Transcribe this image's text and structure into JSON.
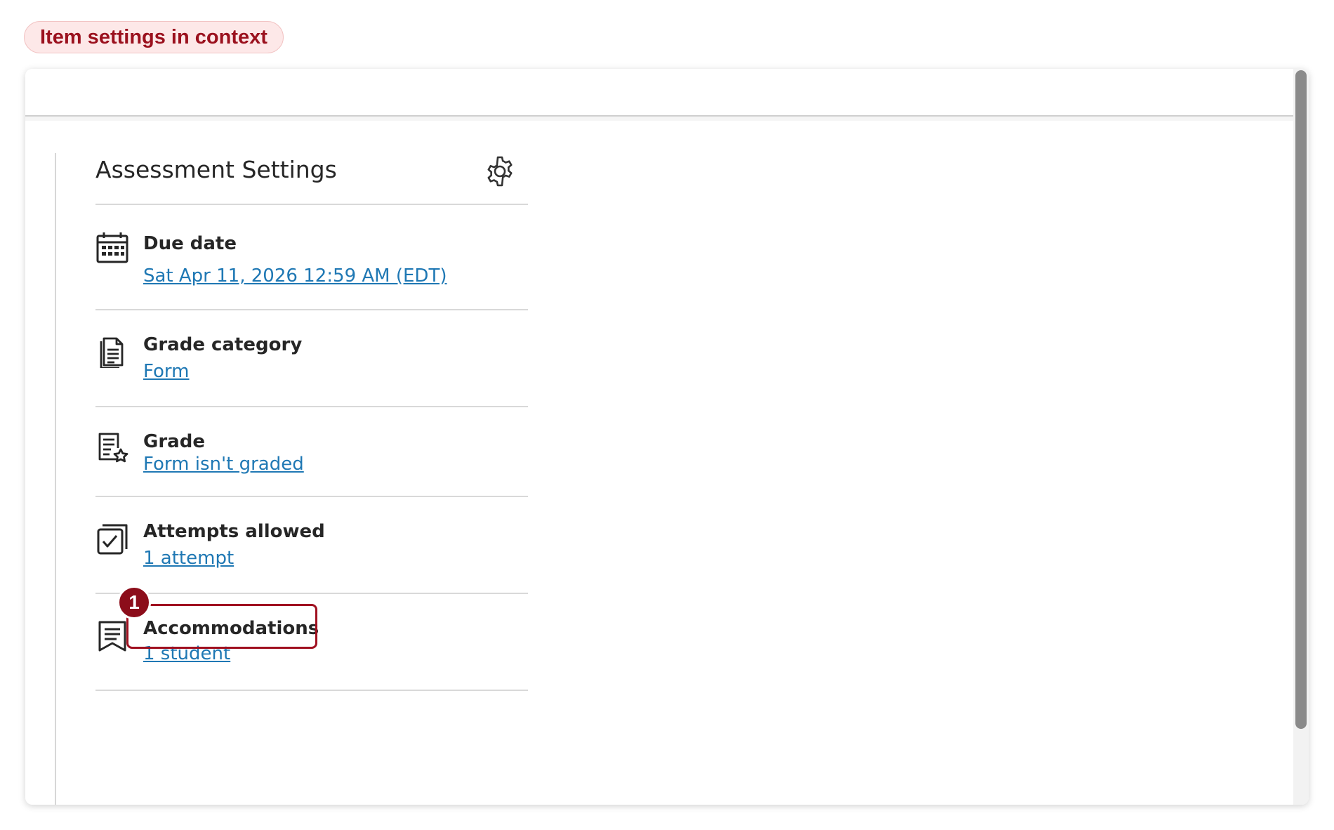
{
  "context_label": "Item settings in context",
  "panel": {
    "title": "Assessment Settings",
    "rows": [
      {
        "label": "Due date",
        "value": "Sat Apr 11, 2026 12:59 AM (EDT)",
        "icon": "calendar-icon"
      },
      {
        "label": "Grade category",
        "value": "Form",
        "icon": "document-icon"
      },
      {
        "label": "Grade",
        "value": "Form isn't graded",
        "icon": "graded-document-star-icon"
      },
      {
        "label": "Attempts allowed",
        "value": "1 attempt",
        "icon": "checkbox-stack-icon"
      },
      {
        "label": "Accommodations",
        "value": "1 student",
        "icon": "bookmark-list-icon"
      }
    ]
  },
  "callout": {
    "number": "1"
  },
  "colors": {
    "accent_red": "#9b111e",
    "link_blue": "#1f78b4",
    "text_dark": "#262626"
  }
}
